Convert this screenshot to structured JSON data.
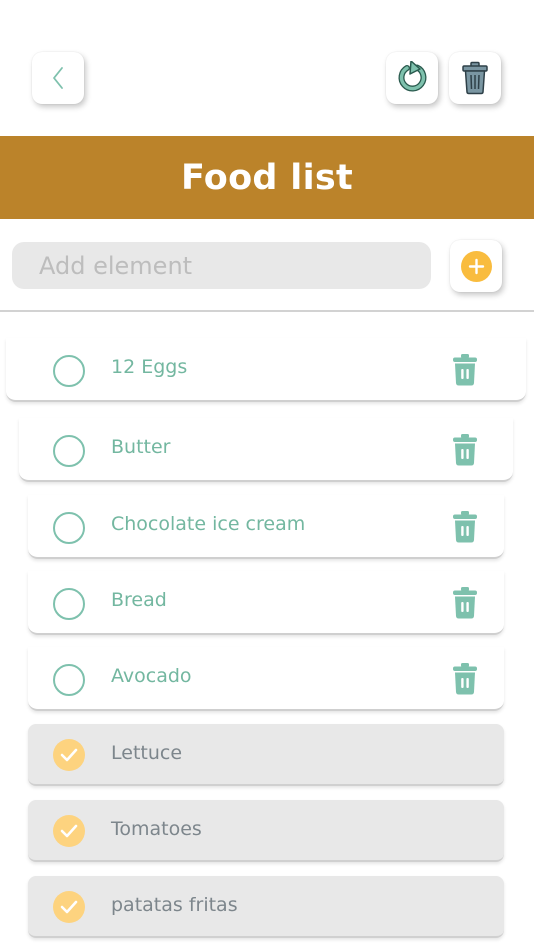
{
  "header": {
    "title": "Food list"
  },
  "add": {
    "placeholder": "Add element"
  },
  "colors": {
    "header_band": "#bb832a",
    "accent_green": "#7ec1ad",
    "check_yellow": "#fdd37f",
    "add_orange": "#f9bc3e"
  },
  "icons": {
    "back": "chevron-left-icon",
    "reset": "reload-icon",
    "delete_all": "trash-icon",
    "add": "plus-icon",
    "item_delete": "trash-icon",
    "item_done": "check-icon"
  },
  "items": [
    {
      "label": "12 Eggs",
      "done": false
    },
    {
      "label": "Butter",
      "done": false
    },
    {
      "label": "Chocolate ice cream",
      "done": false
    },
    {
      "label": "Bread",
      "done": false
    },
    {
      "label": "Avocado",
      "done": false
    },
    {
      "label": "Lettuce",
      "done": true
    },
    {
      "label": "Tomatoes",
      "done": true
    },
    {
      "label": "patatas fritas",
      "done": true
    }
  ]
}
